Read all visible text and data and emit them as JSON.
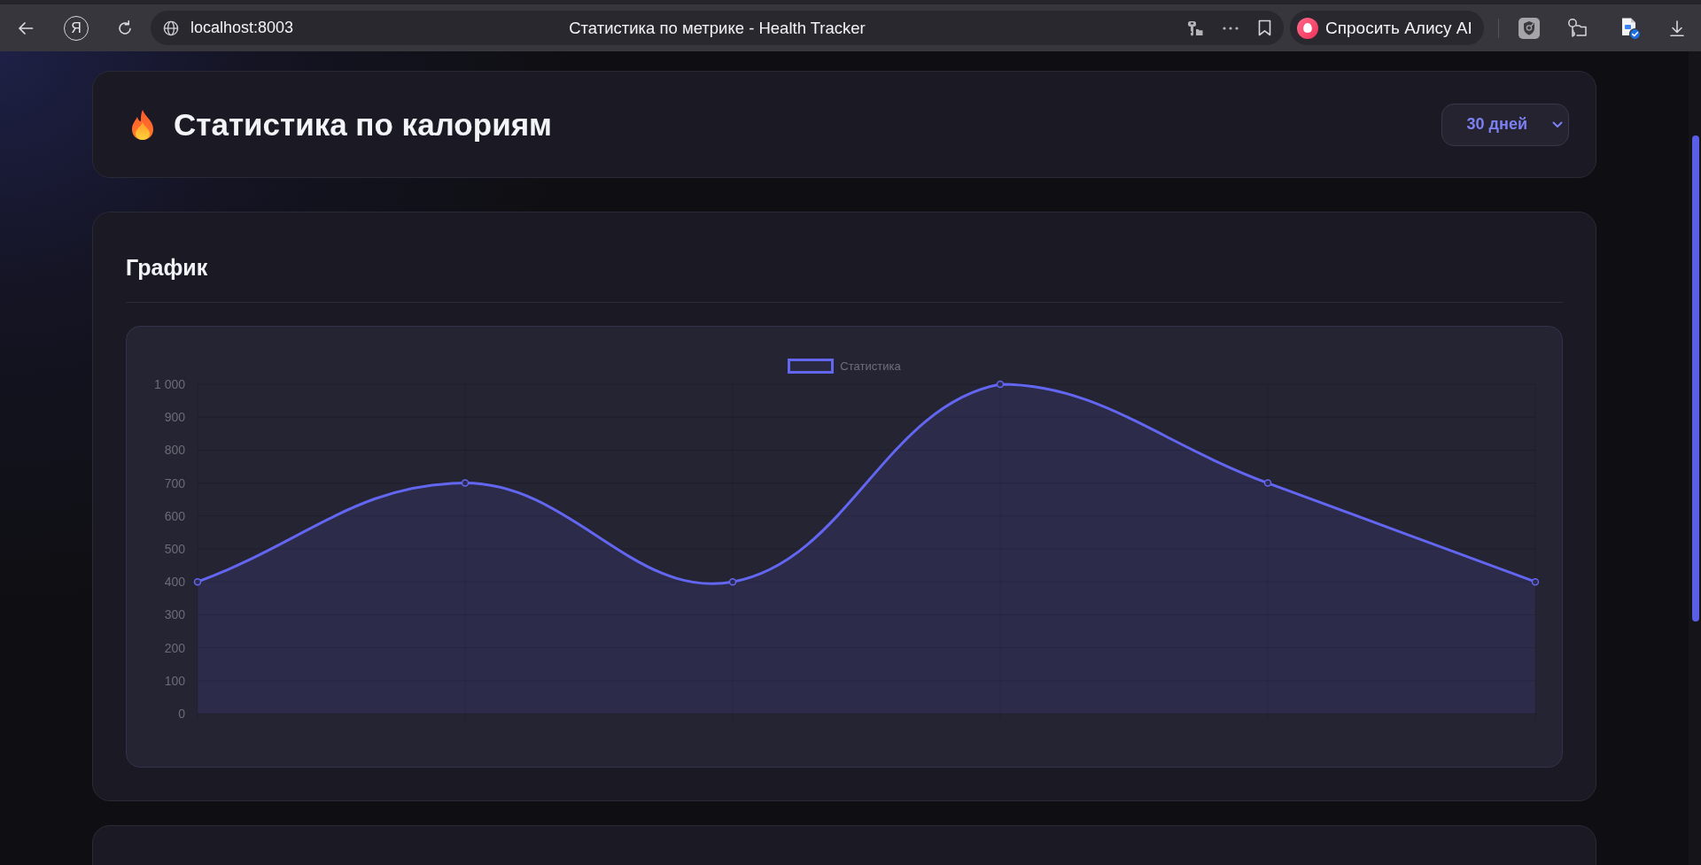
{
  "browser": {
    "logo": "Я",
    "url": "localhost:8003",
    "page_title": "Статистика по метрике - Health Tracker",
    "assistant_button": "Спросить Алису AI"
  },
  "header": {
    "title": "Статистика по калориям",
    "period_select": {
      "value": "30 дней"
    }
  },
  "chart_section": {
    "title": "График",
    "chart_data": {
      "type": "area",
      "grid": true,
      "series": [
        {
          "name": "Статистика",
          "color": "#6366f1",
          "values": [
            400,
            700,
            400,
            1000,
            700,
            400
          ]
        }
      ],
      "ylim": [
        0,
        1000
      ],
      "yticks": [
        0,
        100,
        200,
        300,
        400,
        500,
        600,
        700,
        800,
        900,
        {
          "value": 1000,
          "label": "1 000"
        }
      ]
    }
  }
}
